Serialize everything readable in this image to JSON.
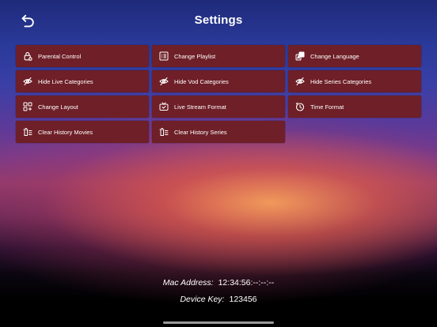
{
  "header": {
    "title": "Settings"
  },
  "tiles": [
    {
      "label": "Parental Control",
      "icon": "lock-icon"
    },
    {
      "label": "Change Playlist",
      "icon": "playlist-icon"
    },
    {
      "label": "Change Language",
      "icon": "language-icon"
    },
    {
      "label": "Hide Live Categories",
      "icon": "eye-off-icon"
    },
    {
      "label": "Hide Vod Categories",
      "icon": "eye-off-icon"
    },
    {
      "label": "Hide Series Categories",
      "icon": "eye-off-icon"
    },
    {
      "label": "Change Layout",
      "icon": "layout-icon"
    },
    {
      "label": "Live Stream Format",
      "icon": "tv-icon"
    },
    {
      "label": "Time Format",
      "icon": "clock-icon"
    },
    {
      "label": "Clear History Movies",
      "icon": "clear-history-icon"
    },
    {
      "label": "Clear History Series",
      "icon": "clear-history-icon"
    }
  ],
  "info": {
    "mac_label": "Mac Address:",
    "mac_value": "12:34:56:--:--:--",
    "device_label": "Device Key:",
    "device_value": "123456"
  },
  "colors": {
    "tile_bg": "#6e1f27",
    "text": "#ffffff"
  }
}
